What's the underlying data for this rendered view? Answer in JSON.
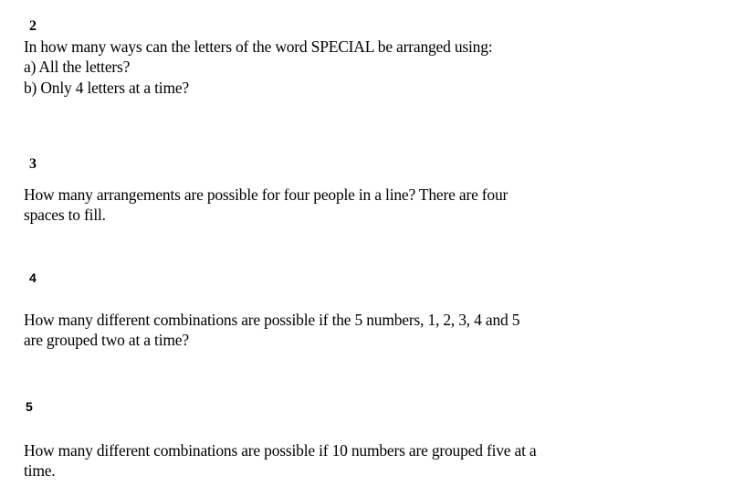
{
  "questions": [
    {
      "number": "2",
      "lines": [
        "In how many ways can the letters of the word SPECIAL  be arranged using:",
        "a) All the letters?",
        "b) Only 4 letters at a time?"
      ]
    },
    {
      "number": "3",
      "lines": [
        "How many arrangements are possible for four people in a line? There are four",
        "spaces to fill."
      ]
    },
    {
      "number": "4",
      "lines": [
        "How many different combinations are possible if the 5 numbers, 1, 2, 3, 4 and 5",
        "are grouped two at a time?"
      ]
    },
    {
      "number": "5",
      "lines": [
        "How many different combinations are possible if 10 numbers are grouped five at a",
        "time."
      ]
    }
  ]
}
